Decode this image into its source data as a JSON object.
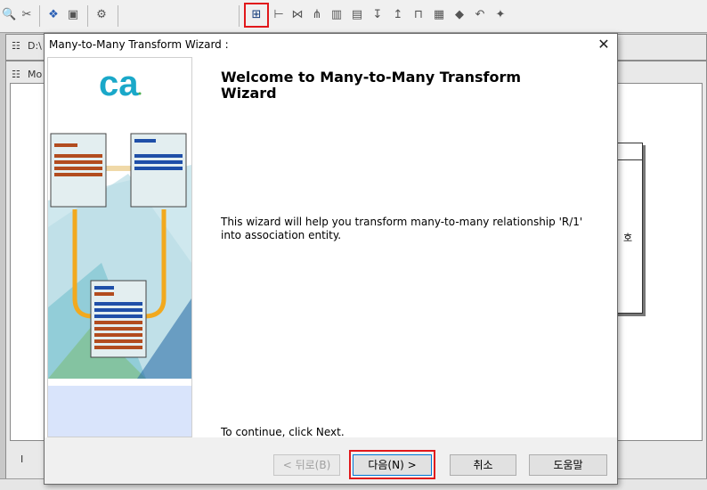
{
  "dialog": {
    "title": "Many-to-Many Transform Wizard :",
    "close_symbol": "✕",
    "heading": "Welcome to Many-to-Many Transform Wizard",
    "description": "This wizard will help you transform many-to-many relationship 'R/1' into association entity.",
    "continue_text": "To continue, click Next.",
    "logo_text": "ca",
    "buttons": {
      "back": "< 뒤로(B)",
      "next": "다음(N) >",
      "cancel": "취소",
      "help": "도움말"
    }
  },
  "background": {
    "pane1_tab": "D:\\",
    "pane2_tab": "Mo",
    "table_text": "호",
    "bottom_tab": "I"
  },
  "icons": {
    "toolbar": [
      "zoom-icon",
      "cut-icon",
      "relationship-icon",
      "clipboard-icon",
      "transform-icon",
      "many-to-many-transform-icon",
      "tree-icon",
      "split-icon",
      "link-icon",
      "columns-icon",
      "rows-icon",
      "sort-down-icon",
      "sort-up-icon",
      "merge-icon",
      "report-icon",
      "diamond-icon",
      "undo-icon",
      "gear-icon"
    ]
  },
  "colors": {
    "highlight": "#e1181b",
    "brand_cyan": "#1aa8c9",
    "brand_green": "#4caf50",
    "side_panel_blue": "#d9e4fb"
  }
}
